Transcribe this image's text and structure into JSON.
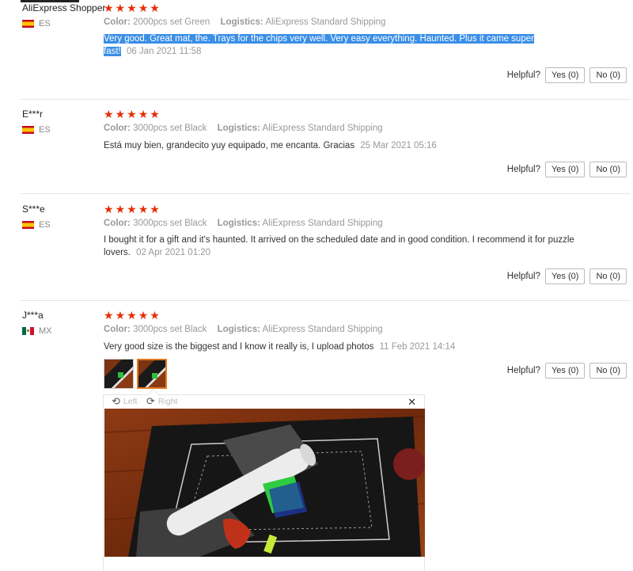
{
  "helpful_label": "Helpful?",
  "yes_label": "Yes (0)",
  "no_label": "No (0)",
  "stars_glyph": "★",
  "colors": {
    "star": "#e62e04",
    "highlight": "#3a8ee6",
    "selected_thumb": "#e07a1f"
  },
  "reviews": [
    {
      "user": "AliExpress Shopper",
      "country": "ES",
      "rating": 5,
      "color_label": "Color:",
      "color_value": "2000pcs set Green",
      "logistics_label": "Logistics:",
      "logistics_value": "AliExpress Standard Shipping",
      "text": "Very good. Great mat, the. Trays for the chips very well. Very easy everything. Haunted. Plus it came super fast!",
      "date": "06 Jan 2021 11:58"
    },
    {
      "user": "E***r",
      "country": "ES",
      "rating": 5,
      "color_label": "Color:",
      "color_value": "3000pcs set Black",
      "logistics_label": "Logistics:",
      "logistics_value": "AliExpress Standard Shipping",
      "text": "Está muy bien, grandecito yuy equipado, me encanta. Gracias",
      "date": "25 Mar 2021 05:16"
    },
    {
      "user": "S***e",
      "country": "ES",
      "rating": 5,
      "color_label": "Color:",
      "color_value": "3000pcs set Black",
      "logistics_label": "Logistics:",
      "logistics_value": "AliExpress Standard Shipping",
      "text": "I bought it for a gift and it's haunted. It arrived on the scheduled date and in good condition. I recommend it for puzzle lovers.",
      "date": "02 Apr 2021 01:20"
    },
    {
      "user": "J***a",
      "country": "MX",
      "rating": 5,
      "color_label": "Color:",
      "color_value": "3000pcs set Black",
      "logistics_label": "Logistics:",
      "logistics_value": "AliExpress Standard Shipping",
      "text": "Very good size is the biggest and I know it really is, I upload photos",
      "date": "11 Feb 2021 14:14"
    }
  ],
  "viewer": {
    "rotate_left_label": "Left",
    "rotate_right_label": "Right",
    "close_glyph": "✕"
  }
}
